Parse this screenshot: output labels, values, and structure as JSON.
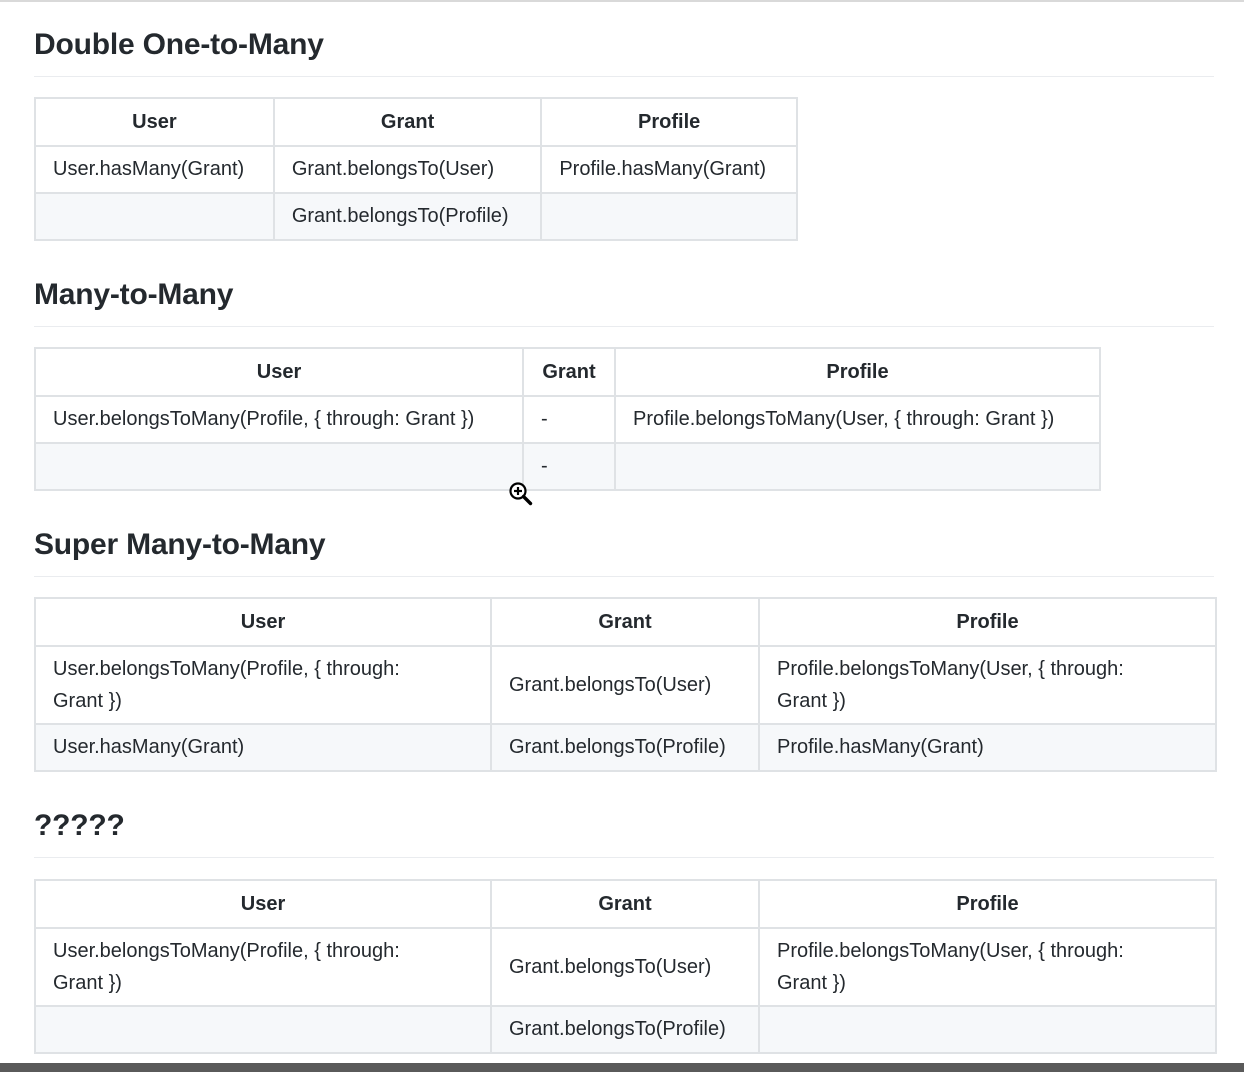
{
  "sections": [
    {
      "heading": "Double One-to-Many",
      "headers": [
        "User",
        "Grant",
        "Profile"
      ],
      "rows": [
        [
          "User.hasMany(Grant)",
          "Grant.belongsTo(User)",
          "Profile.hasMany(Grant)"
        ],
        [
          "",
          "Grant.belongsTo(Profile)",
          ""
        ]
      ]
    },
    {
      "heading": "Many-to-Many",
      "headers": [
        "User",
        "Grant",
        "Profile"
      ],
      "rows": [
        [
          "User.belongsToMany(Profile, { through: Grant })",
          "-",
          "Profile.belongsToMany(User, { through: Grant })"
        ],
        [
          "",
          "-",
          ""
        ]
      ]
    },
    {
      "heading": "Super Many-to-Many",
      "headers": [
        "User",
        "Grant",
        "Profile"
      ],
      "rows": [
        [
          "User.belongsToMany(Profile, { through: Grant })",
          "Grant.belongsTo(User)",
          "Profile.belongsToMany(User, { through: Grant })"
        ],
        [
          "User.hasMany(Grant)",
          "Grant.belongsTo(Profile)",
          "Profile.hasMany(Grant)"
        ]
      ]
    },
    {
      "heading": "?????",
      "headers": [
        "User",
        "Grant",
        "Profile"
      ],
      "rows": [
        [
          "User.belongsToMany(Profile, { through: Grant })",
          "Grant.belongsTo(User)",
          "Profile.belongsToMany(User, { through: Grant })"
        ],
        [
          "",
          "Grant.belongsTo(Profile)",
          ""
        ]
      ]
    }
  ],
  "cursor_icon": "zoom-in-icon"
}
